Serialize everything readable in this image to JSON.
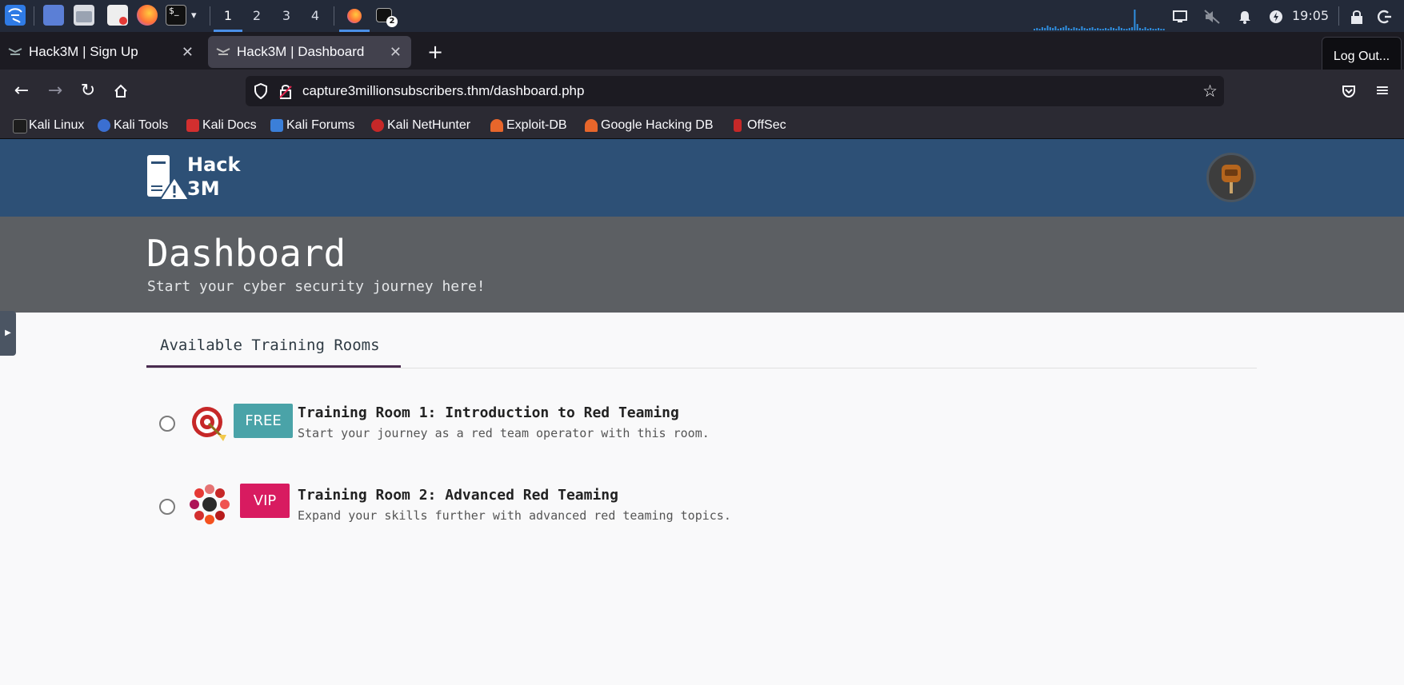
{
  "os_taskbar": {
    "workspaces": [
      "1",
      "2",
      "3",
      "4"
    ],
    "active_workspace": "1",
    "terminal_badge": "2",
    "clock": "19:05",
    "icons": [
      "kali-menu-icon",
      "desktop-icon",
      "file-manager-icon",
      "text-editor-icon",
      "firefox-icon",
      "terminal-icon",
      "chevron-down-icon",
      "firefox-window-icon",
      "terminal-window-icon",
      "display-icon",
      "volume-muted-icon",
      "bell-icon",
      "power-manager-icon",
      "lock-icon",
      "logout-icon"
    ]
  },
  "browser": {
    "tabs": [
      {
        "title": "Hack3M | Sign Up",
        "active": false
      },
      {
        "title": "Hack3M | Dashboard",
        "active": true
      }
    ],
    "tooltip": "Log Out...",
    "url": "capture3millionsubscribers.thm/dashboard.php",
    "bookmarks": [
      "Kali Linux",
      "Kali Tools",
      "Kali Docs",
      "Kali Forums",
      "Kali NetHunter",
      "Exploit-DB",
      "Google Hacking DB",
      "OffSec"
    ],
    "colors": {
      "tabstrip": "#1c1b22",
      "toolbar": "#2b2a33",
      "active_tab": "#42414d"
    }
  },
  "site": {
    "logo_line1": "Hack",
    "logo_line2": "3M",
    "hero_title": "Dashboard",
    "hero_subtitle": "Start your cyber security journey here!",
    "tab_label": "Available Training Rooms",
    "rooms": [
      {
        "badge": "FREE",
        "badge_color": "#4aa3a8",
        "icon": "target-icon",
        "title": "Training Room 1: Introduction to Red Teaming",
        "description": "Start your journey as a red team operator with this room."
      },
      {
        "badge": "VIP",
        "badge_color": "#d81b60",
        "icon": "red-team-cluster-icon",
        "title": "Training Room 2: Advanced Red Teaming",
        "description": "Expand your skills further with advanced red teaming topics."
      }
    ],
    "colors": {
      "header": "#2d5076",
      "hero": "#5c5f63",
      "tab_underline": "#4a2c4f"
    }
  }
}
